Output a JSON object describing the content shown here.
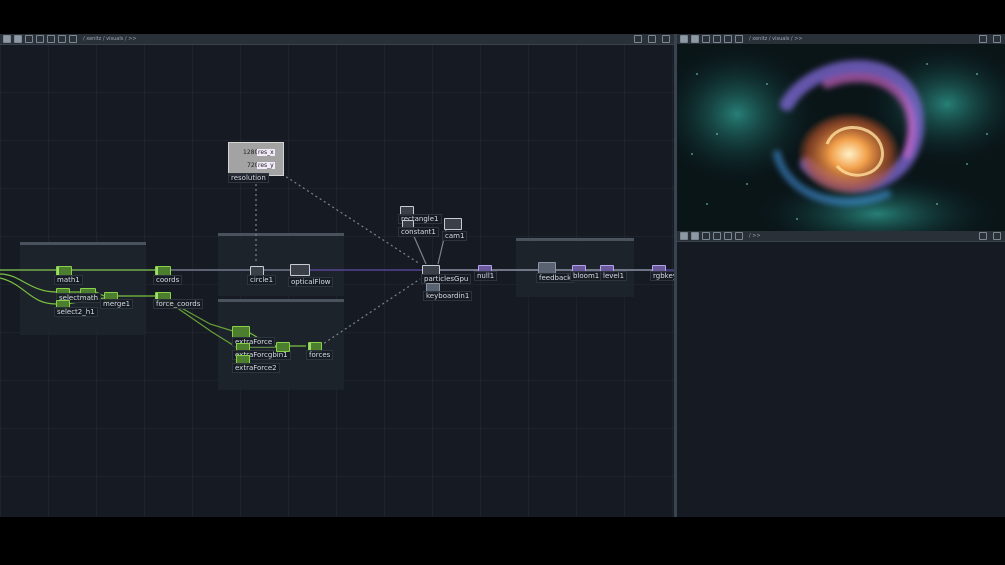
{
  "network_pane": {
    "path": "/ xenitz / visuals / >>",
    "nodes": {
      "resolution": {
        "label": "resolution",
        "val1": "1280",
        "tag1": "res_x",
        "val2": "720",
        "tag2": "res_y"
      },
      "math1": "math1",
      "select_math": "selectmath",
      "select2": "select2_h1",
      "merge1": "merge1",
      "coords": "coords",
      "force_coords": "force_coords",
      "circle1": "circle1",
      "optical_flow": "opticalFlow",
      "extra_force": "extraForce",
      "extra_force_gbin": "extraForcgbin1",
      "extra_force2": "extraForce2",
      "forces": "forces",
      "rectangle1": "rectangle1",
      "constant1": "constant1",
      "cam1": "cam1",
      "particles_gpu": "particlesGpu",
      "null1": "null1",
      "keyboardin1": "keyboardin1",
      "feedback": "feedback",
      "bloom1": "bloom1",
      "level1": "level1",
      "rgbkey": "rgbkey"
    }
  },
  "viewer_pane": {
    "path": "/ xenitz / visuals / >>"
  },
  "bottom_right_pane": {
    "path": "/ >>"
  },
  "colors": {
    "chop": "#8ad14a",
    "top": "#c7ccd4",
    "sop": "#b3a2f0",
    "wire_main": "#7a5ad6",
    "wire_green": "#7ac23d"
  }
}
